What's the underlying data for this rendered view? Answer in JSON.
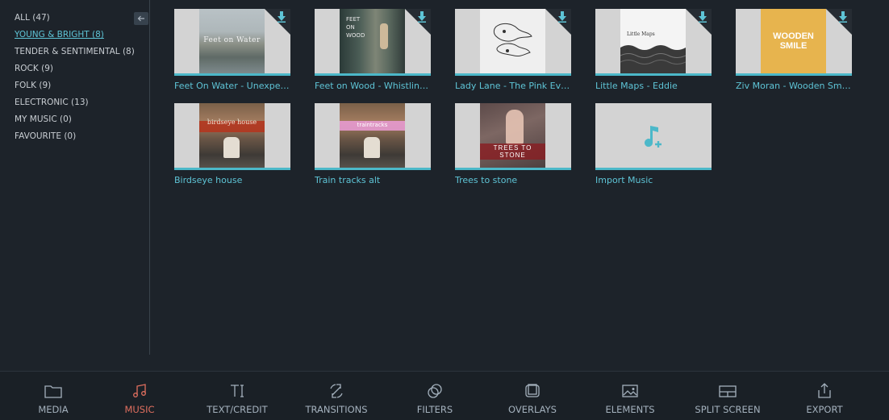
{
  "sidebar": {
    "categories": [
      {
        "label": "ALL (47)"
      },
      {
        "label": "YOUNG & BRIGHT (8)"
      },
      {
        "label": "TENDER & SENTIMENTAL (8)"
      },
      {
        "label": "ROCK (9)"
      },
      {
        "label": "FOLK (9)"
      },
      {
        "label": "ELECTRONIC (13)"
      },
      {
        "label": "MY MUSIC (0)"
      },
      {
        "label": "FAVOURITE (0)"
      }
    ],
    "active_index": 1,
    "collapse_icon": "arrow-left-icon"
  },
  "tracks": [
    {
      "title": "Feet On Water - Unexpect...",
      "cover_text": "Feet on Water",
      "downloadable": true
    },
    {
      "title": "Feet on Wood - Whistling ...",
      "cover_text": "FEET ON WOOD",
      "downloadable": true
    },
    {
      "title": "Lady Lane - The Pink Everl...",
      "cover_text": "",
      "downloadable": true
    },
    {
      "title": "Little Maps - Eddie",
      "cover_text": "Little Maps",
      "downloadable": true
    },
    {
      "title": "Ziv Moran - Wooden Smil...",
      "cover_text": "WOODEN SMILE",
      "downloadable": true
    },
    {
      "title": "Birdseye house",
      "cover_text": "birdseye house",
      "downloadable": false
    },
    {
      "title": "Train tracks alt",
      "cover_text": "traintracks",
      "downloadable": false
    },
    {
      "title": "Trees to stone",
      "cover_text": "TREES TO STONE",
      "downloadable": false
    }
  ],
  "import": {
    "label": "Import Music",
    "icon": "music-note-plus-icon"
  },
  "toolbar": {
    "items": [
      {
        "label": "MEDIA",
        "icon": "folder-icon"
      },
      {
        "label": "MUSIC",
        "icon": "music-note-icon"
      },
      {
        "label": "TEXT/CREDIT",
        "icon": "text-cursor-icon"
      },
      {
        "label": "TRANSITIONS",
        "icon": "transition-icon"
      },
      {
        "label": "FILTERS",
        "icon": "filters-icon"
      },
      {
        "label": "OVERLAYS",
        "icon": "overlays-icon"
      },
      {
        "label": "ELEMENTS",
        "icon": "image-icon"
      },
      {
        "label": "SPLIT SCREEN",
        "icon": "split-screen-icon"
      },
      {
        "label": "EXPORT",
        "icon": "export-icon"
      }
    ],
    "active_index": 1
  },
  "colors": {
    "background": "#1d232a",
    "accent": "#5ec4d6",
    "active_tool": "#e06f5f",
    "thumb_bg": "#d3d3d3"
  }
}
